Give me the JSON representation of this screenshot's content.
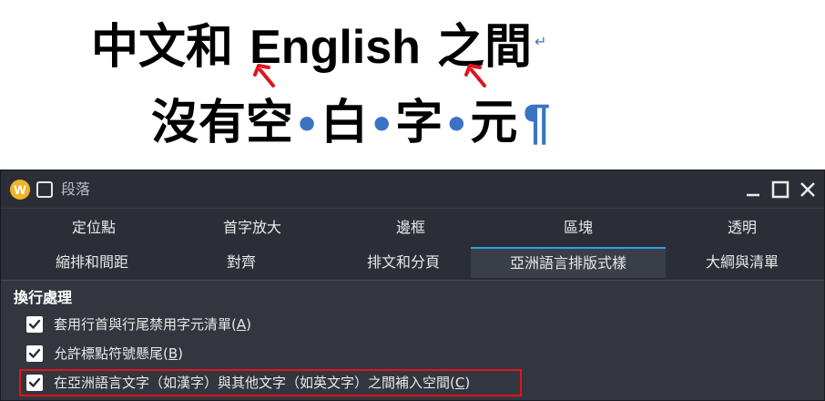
{
  "document": {
    "line1": {
      "cjk_head": "中文和",
      "latin": "English",
      "cjk_tail": "之間",
      "line_break_mark": "↵"
    },
    "line2": {
      "chars": [
        "沒有空",
        "白",
        "字",
        "元"
      ],
      "space_mark": "•",
      "paragraph_mark": "¶"
    },
    "marks_color": "#3b73c4",
    "arrow_color": "#e0141e"
  },
  "dialog": {
    "title": "段落",
    "title_icon": "writer-app-icon",
    "tabs_row1": [
      "定位點",
      "首字放大",
      "邊框",
      "區塊",
      "透明"
    ],
    "tabs_row2": [
      "縮排和間距",
      "對齊",
      "排文和分頁",
      "亞洲語言排版式樣",
      "大綱與清單"
    ],
    "active_tab": "亞洲語言排版式樣",
    "accent": "#2f9fe0",
    "section_title": "換行處理",
    "options": [
      {
        "label": "套用行首與行尾禁用字元清單(",
        "key": "A",
        "close": ")",
        "checked": true
      },
      {
        "label": "允許標點符號懸尾(",
        "key": "B",
        "close": ")",
        "checked": true
      },
      {
        "label": "在亞洲語言文字（如漢字）與其他文字（如英文字）之間補入空間(",
        "key": "C",
        "close": ")",
        "checked": true
      }
    ],
    "highlight_color": "#e0141e"
  }
}
